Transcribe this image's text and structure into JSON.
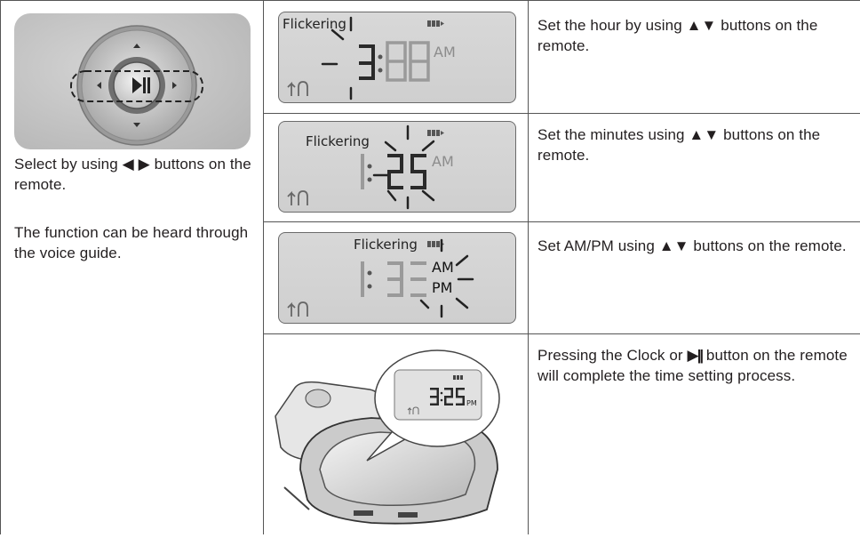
{
  "left_panel": {
    "instruction": "Select by using ◀ ▶ buttons on the remote.",
    "voice_note": "The function can be heard through the voice guide."
  },
  "steps": [
    {
      "display": {
        "flicker_label": "Flickering",
        "am_pm": "AM"
      },
      "text": "Set the hour by using ▲▼ buttons on the remote."
    },
    {
      "display": {
        "flicker_label": "Flickering",
        "am_pm": "AM"
      },
      "text": "Set the minutes using ▲▼ buttons on the remote."
    },
    {
      "display": {
        "flicker_label": "Flickering",
        "am_label": "AM",
        "pm_label": "PM"
      },
      "text": "Set AM/PM using ▲▼ buttons on the remote."
    },
    {
      "display": {
        "am_pm": "PM"
      },
      "text_before": "Pressing the Clock or",
      "button_glyph": "▶||",
      "text_after": "button on the remote will complete the time setting process."
    }
  ]
}
